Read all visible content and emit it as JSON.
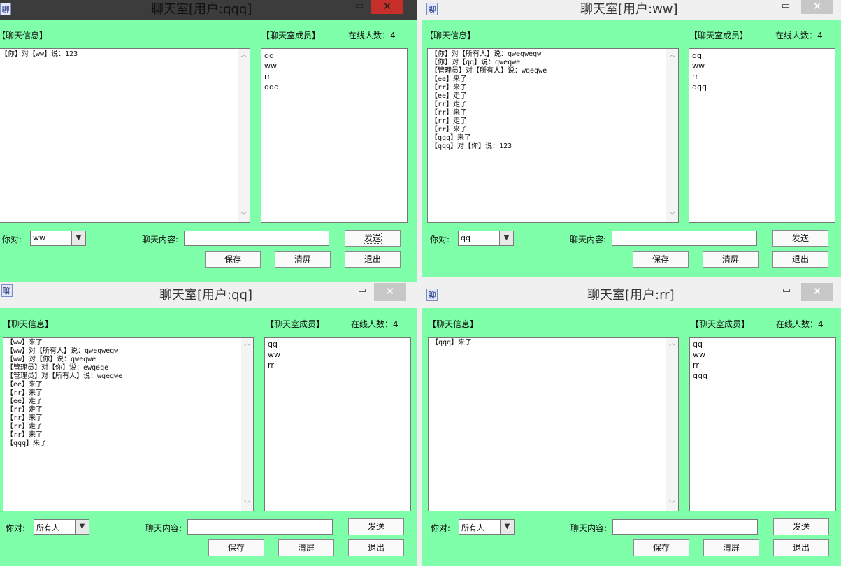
{
  "labels": {
    "chat_info": "【聊天信息】",
    "members": "【聊天室成员】",
    "online": "在线人数：4",
    "to": "你对:",
    "content": "聊天内容:",
    "send": "发送",
    "save": "保存",
    "clear": "清屏",
    "exit": "退出",
    "app_icon": "聊"
  },
  "windows": [
    {
      "title": "聊天室[用户:qqq]",
      "target": "ww",
      "messages": [
        "【你】对【ww】说：123"
      ],
      "members": [
        "qq",
        "ww",
        "rr",
        "qqq"
      ]
    },
    {
      "title": "聊天室[用户:ww]",
      "target": "qq",
      "messages": [
        "【你】对【所有人】说：qweqweqw",
        "【你】对【qq】说：qweqwe",
        "【管理员】对【所有人】说：wqeqwe",
        "【ee】来了",
        "【rr】来了",
        "【ee】走了",
        "【rr】走了",
        "【rr】来了",
        "【rr】走了",
        "【rr】来了",
        "【qqq】来了",
        "【qqq】对【你】说：123"
      ],
      "members": [
        "qq",
        "ww",
        "rr",
        "qqq"
      ]
    },
    {
      "title": "聊天室[用户:qq]",
      "target": "所有人",
      "messages": [
        "【ww】来了",
        "【ww】对【所有人】说：qweqweqw",
        "【ww】对【你】说：qweqwe",
        "【管理员】对【你】说：ewqeqe",
        "【管理员】对【所有人】说：wqeqwe",
        "【ee】来了",
        "【rr】来了",
        "【ee】走了",
        "【rr】走了",
        "【rr】来了",
        "【rr】走了",
        "【rr】来了",
        "【qqq】来了"
      ],
      "members": [
        "qq",
        "ww",
        "rr"
      ]
    },
    {
      "title": "聊天室[用户:rr]",
      "target": "所有人",
      "messages": [
        "【qqq】来了"
      ],
      "members": [
        "qq",
        "ww",
        "rr",
        "qqq"
      ]
    }
  ]
}
